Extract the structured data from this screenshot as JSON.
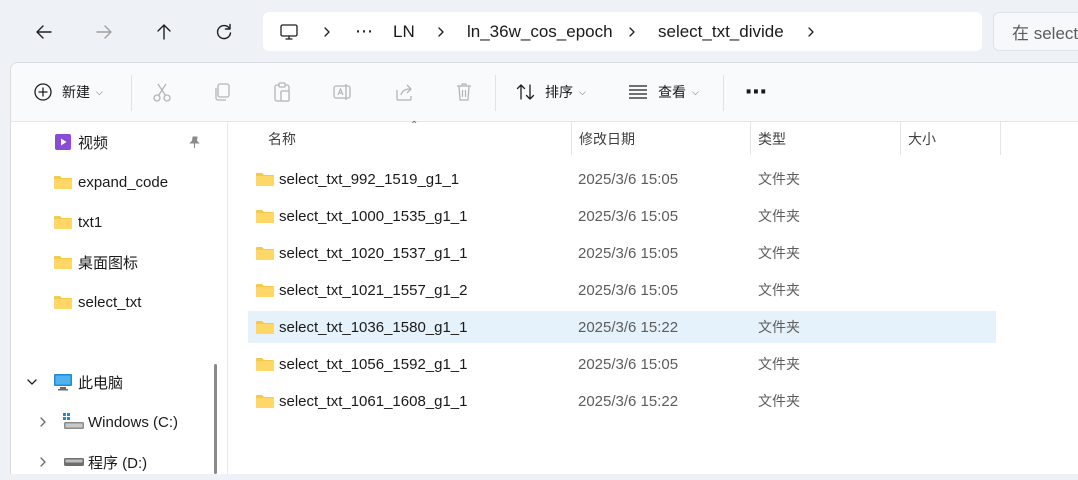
{
  "nav": {
    "back_icon": "arrow-left-icon",
    "forward_icon": "arrow-right-icon",
    "up_icon": "arrow-up-icon",
    "refresh_icon": "refresh-icon"
  },
  "address": {
    "segments": [
      "LN",
      "ln_36w_cos_epoch",
      "select_txt_divide"
    ],
    "overflow": "⋯"
  },
  "search": {
    "placeholder": "在 select"
  },
  "toolbar": {
    "new_label": "新建",
    "sort_label": "排序",
    "view_label": "查看",
    "more": "⋯"
  },
  "sidebar": {
    "items": [
      {
        "label": "视频",
        "icon": "video-folder-icon",
        "pinned": true
      },
      {
        "label": "expand_code",
        "icon": "folder-icon"
      },
      {
        "label": "txt1",
        "icon": "folder-icon"
      },
      {
        "label": "桌面图标",
        "icon": "folder-icon"
      },
      {
        "label": "select_txt",
        "icon": "folder-icon"
      },
      {
        "label": "此电脑",
        "icon": "computer-icon",
        "expanded": true
      },
      {
        "label": "Windows (C:)",
        "icon": "windows-drive-icon",
        "collapsed": true
      },
      {
        "label": "程序 (D:)",
        "icon": "drive-icon",
        "collapsed": true
      }
    ]
  },
  "columns": {
    "name": "名称",
    "date": "修改日期",
    "type": "类型",
    "size": "大小"
  },
  "files": [
    {
      "name": "select_txt_992_1519_g1_1",
      "date": "2025/3/6 15:05",
      "type": "文件夹"
    },
    {
      "name": "select_txt_1000_1535_g1_1",
      "date": "2025/3/6 15:05",
      "type": "文件夹"
    },
    {
      "name": "select_txt_1020_1537_g1_1",
      "date": "2025/3/6 15:05",
      "type": "文件夹"
    },
    {
      "name": "select_txt_1021_1557_g1_2",
      "date": "2025/3/6 15:05",
      "type": "文件夹"
    },
    {
      "name": "select_txt_1036_1580_g1_1",
      "date": "2025/3/6 15:22",
      "type": "文件夹",
      "selected": true
    },
    {
      "name": "select_txt_1056_1592_g1_1",
      "date": "2025/3/6 15:05",
      "type": "文件夹"
    },
    {
      "name": "select_txt_1061_1608_g1_1",
      "date": "2025/3/6 15:22",
      "type": "文件夹"
    }
  ],
  "colors": {
    "accent": "#0067c0",
    "folder": "#f6c94a",
    "selection": "#e5f1fb"
  }
}
